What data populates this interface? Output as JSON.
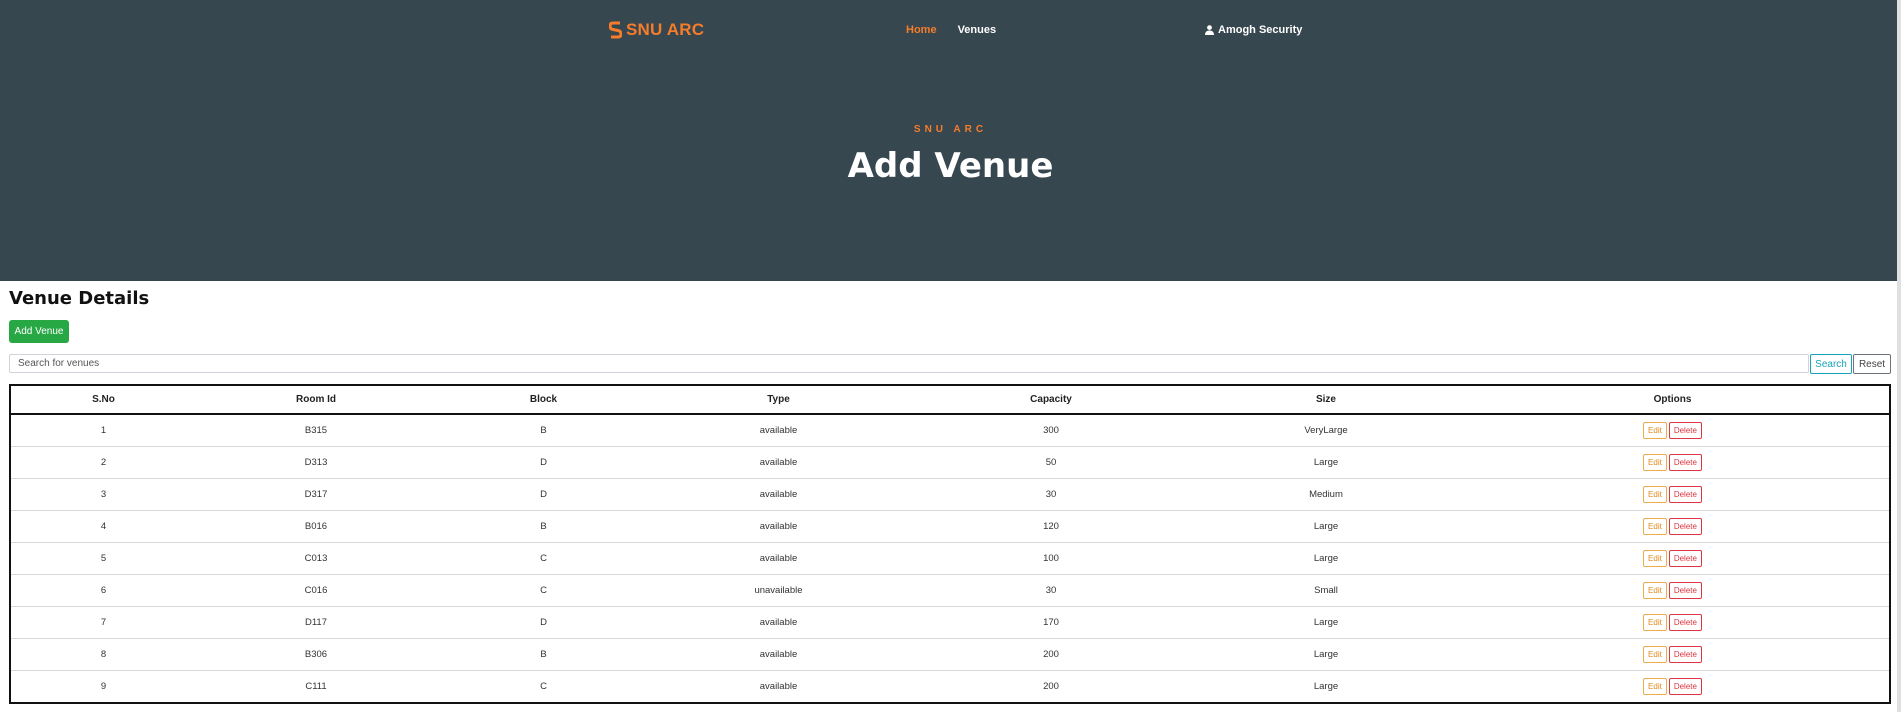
{
  "brand": {
    "name": "SNU ARC",
    "color": "#f57c2a"
  },
  "nav": {
    "items": [
      {
        "label": "Home",
        "active": true
      },
      {
        "label": "Venues",
        "active": false
      }
    ]
  },
  "user": {
    "name": "Amogh Security",
    "icon": "user-icon"
  },
  "hero": {
    "eyebrow": "SNU ARC",
    "title": "Add Venue",
    "bg": "#37474f"
  },
  "section": {
    "title": "Venue Details"
  },
  "toolbar": {
    "add_label": "Add Venue",
    "search_placeholder": "Search for venues",
    "search_label": "Search",
    "reset_label": "Reset"
  },
  "table": {
    "columns": [
      "S.No",
      "Room Id",
      "Block",
      "Type",
      "Capacity",
      "Size",
      "Options"
    ],
    "edit_label": "Edit",
    "delete_label": "Delete",
    "rows": [
      [
        "1",
        "B315",
        "B",
        "available",
        "300",
        "VeryLarge"
      ],
      [
        "2",
        "D313",
        "D",
        "available",
        "50",
        "Large"
      ],
      [
        "3",
        "D317",
        "D",
        "available",
        "30",
        "Medium"
      ],
      [
        "4",
        "B016",
        "B",
        "available",
        "120",
        "Large"
      ],
      [
        "5",
        "C013",
        "C",
        "available",
        "100",
        "Large"
      ],
      [
        "6",
        "C016",
        "C",
        "unavailable",
        "30",
        "Small"
      ],
      [
        "7",
        "D117",
        "D",
        "available",
        "170",
        "Large"
      ],
      [
        "8",
        "B306",
        "B",
        "available",
        "200",
        "Large"
      ],
      [
        "9",
        "C111",
        "C",
        "available",
        "200",
        "Large"
      ]
    ]
  }
}
